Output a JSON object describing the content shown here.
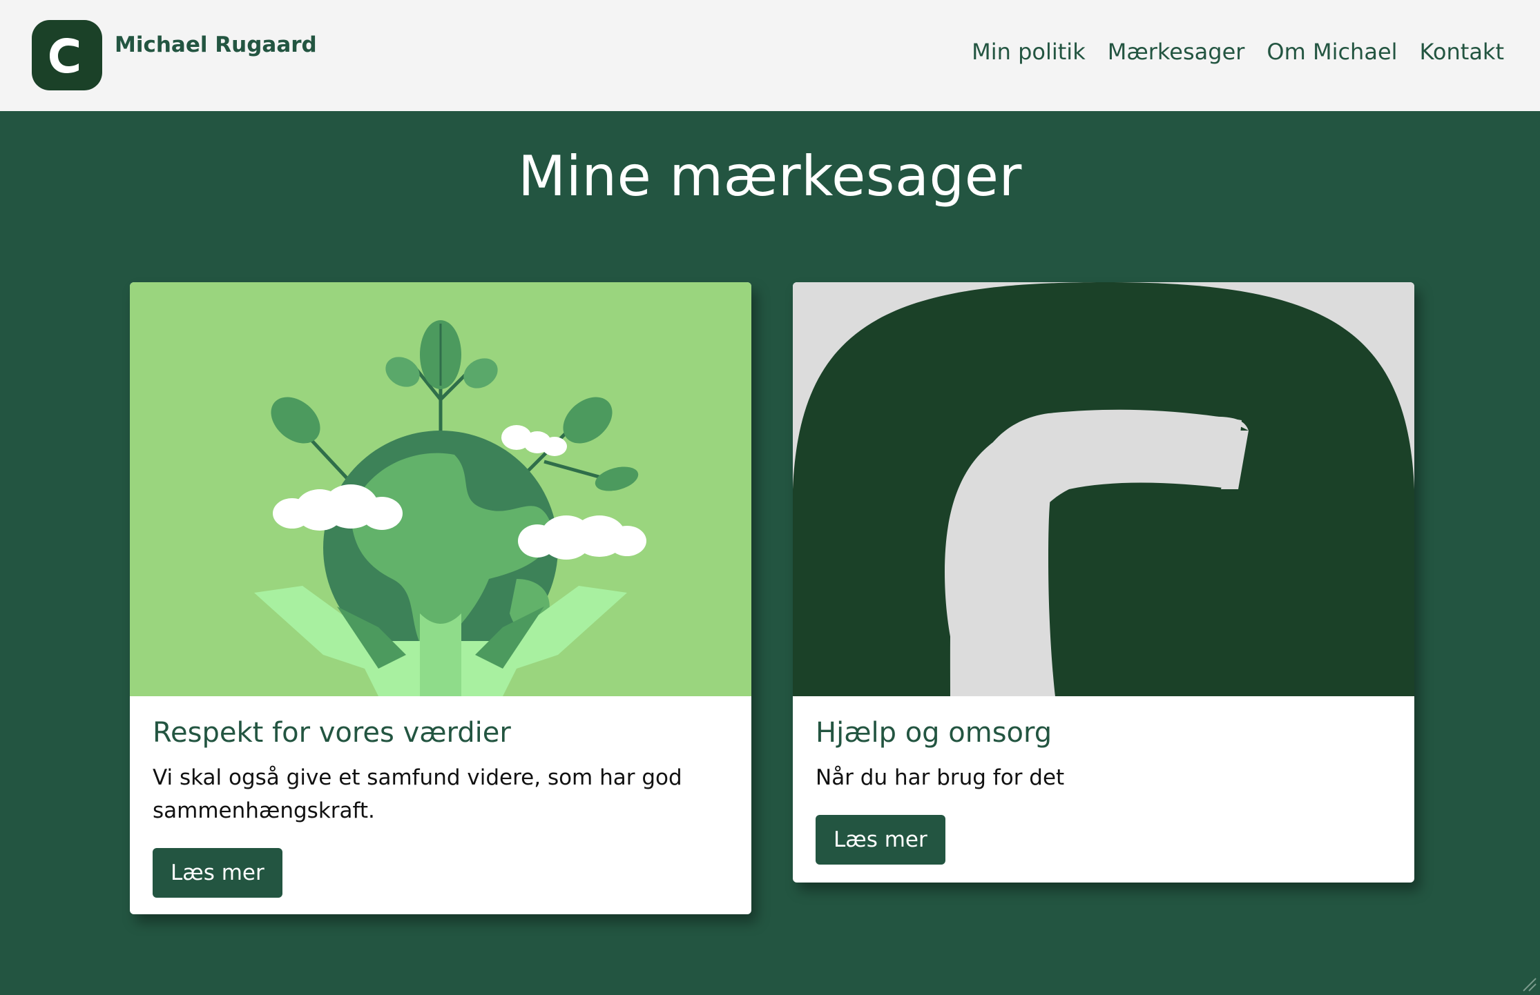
{
  "brand": {
    "logo_icon": "c-logo-icon",
    "name": "Michael Rugaard"
  },
  "nav": {
    "items": [
      {
        "label": "Min politik"
      },
      {
        "label": "Mærkesager"
      },
      {
        "label": "Om Michael"
      },
      {
        "label": "Kontakt"
      }
    ]
  },
  "section": {
    "title": "Mine mærkesager"
  },
  "cards": [
    {
      "image_icon": "earth-in-hands-illustration",
      "title": "Respekt for vores værdier",
      "text": "Vi skal også give et samfund videre, som har god sammenhængskraft.",
      "button_label": "Læs mer"
    },
    {
      "image_icon": "c-logo-illustration",
      "title": "Hjælp og omsorg",
      "text": "Når du har brug for det",
      "button_label": "Læs mer"
    }
  ],
  "colors": {
    "primary": "#235541",
    "navbar_bg": "#f4f4f4",
    "card_bg": "#ffffff",
    "logo_dark": "#1b4128"
  }
}
